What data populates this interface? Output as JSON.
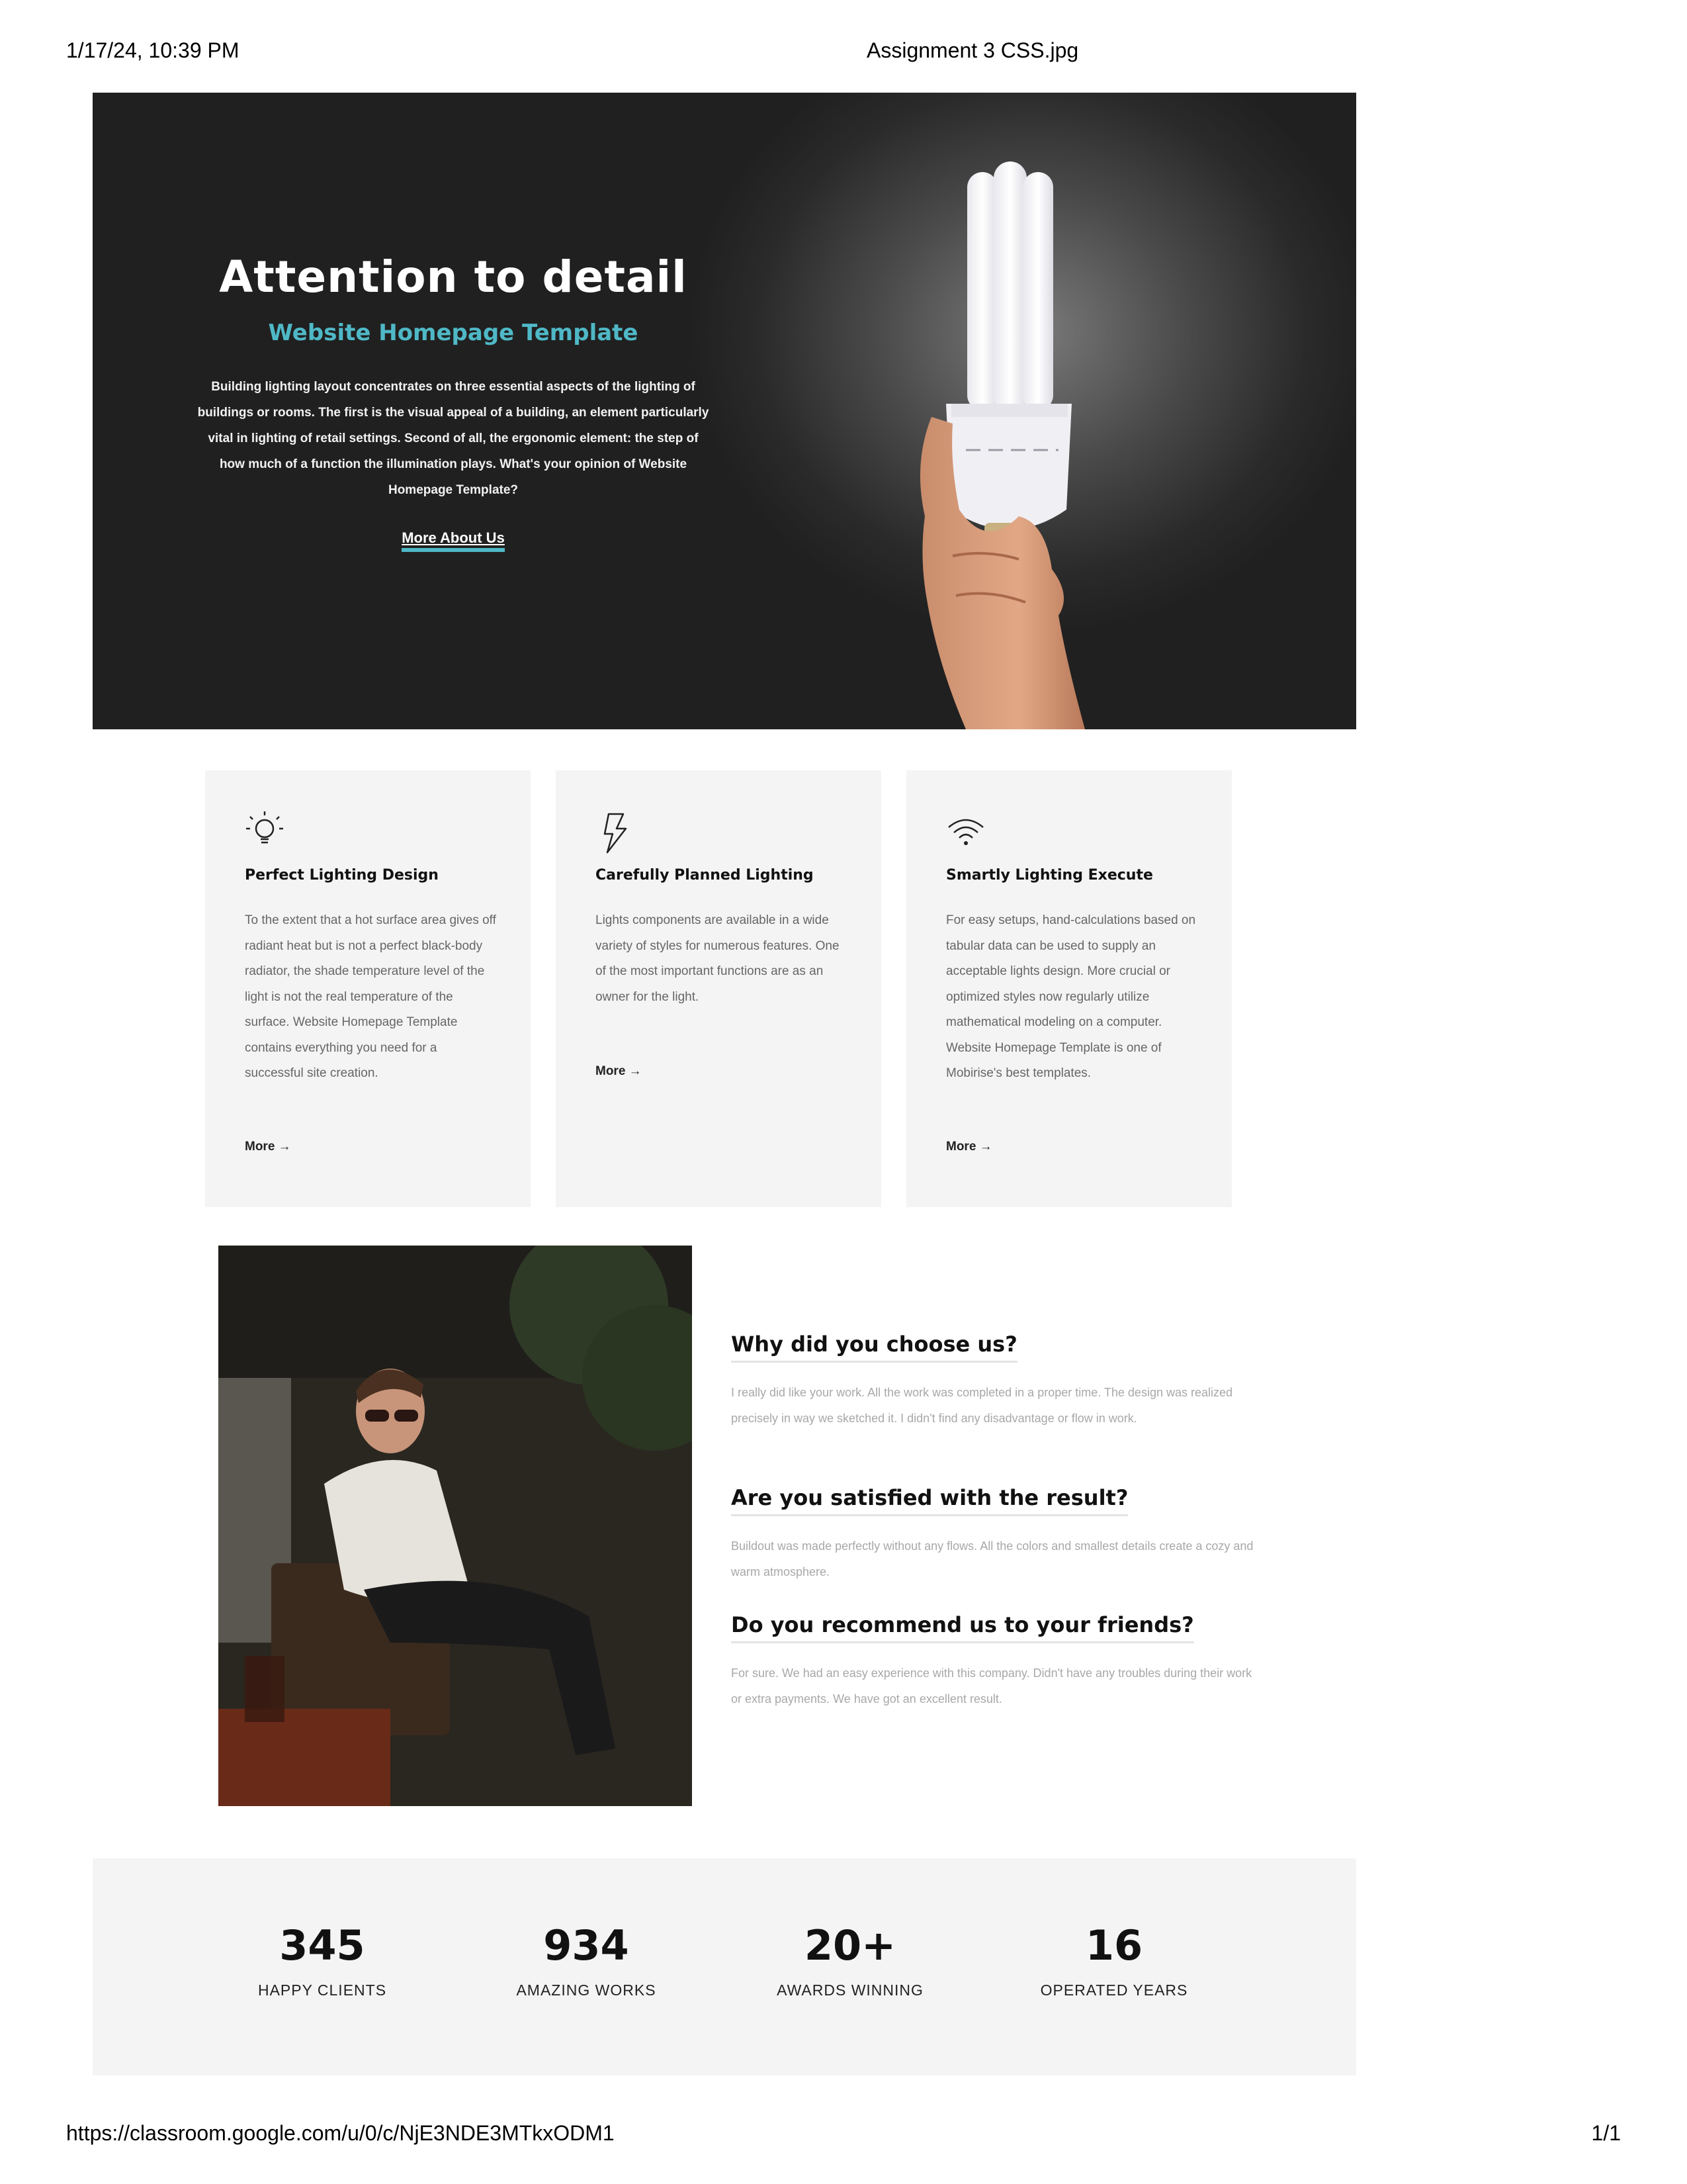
{
  "print": {
    "datetime": "1/17/24, 10:39 PM",
    "filename": "Assignment 3 CSS.jpg",
    "url": "https://classroom.google.com/u/0/c/NjE3NDE3MTkxODM1",
    "page": "1/1"
  },
  "hero": {
    "title": "Attention to detail",
    "subtitle": "Website Homepage Template",
    "body": "Building lighting layout concentrates on three essential aspects of the lighting of buildings or rooms. The first is the visual appeal of a building, an element particularly vital in lighting of retail settings. Second of all, the ergonomic element: the step of how much of a function the illumination plays. What's your opinion of Website Homepage Template?",
    "link": "More About Us"
  },
  "features": [
    {
      "icon": "bulb-icon",
      "title": "Perfect Lighting Design",
      "body": "To the extent that a hot surface area gives off radiant heat but is not a perfect black-body radiator, the shade temperature level of the light is not the real temperature of the surface. Website Homepage Template contains everything you need for a successful site creation.",
      "more": "More →"
    },
    {
      "icon": "lightning-icon",
      "title": "Carefully Planned Lighting",
      "body": "Lights components are available in a wide variety of styles for numerous features. One of the most important functions are as an owner for the light.",
      "more": "More →"
    },
    {
      "icon": "wifi-icon",
      "title": "Smartly Lighting Execute",
      "body": "For easy setups, hand-calculations based on tabular data can be used to supply an acceptable lights design. More crucial or optimized styles now regularly utilize mathematical modeling on a computer. Website Homepage Template is one of Mobirise's best templates.",
      "more": "More →"
    }
  ],
  "faq": [
    {
      "q": "Why did you choose us?",
      "a": "I really did like your work. All the work was completed in a proper time. The design was realized precisely in way we sketched it. I didn't find any disadvantage or flow in work."
    },
    {
      "q": "Are you satisfied with the result?",
      "a": "Buildout was made perfectly without any flows. All the colors and smallest details create a cozy and warm atmosphere."
    },
    {
      "q": "Do you recommend us to your friends?",
      "a": "For sure. We had an easy experience with this company. Didn't have any troubles during their work or extra payments. We have got an excellent result."
    }
  ],
  "stats": [
    {
      "number": "345",
      "label": "HAPPY CLIENTS"
    },
    {
      "number": "934",
      "label": "AMAZING WORKS"
    },
    {
      "number": "20+",
      "label": "AWARDS WINNING"
    },
    {
      "number": "16",
      "label": "OPERATED YEARS"
    }
  ],
  "colors": {
    "accent": "#4fb8c6",
    "hero_bg": "#2a2a2a",
    "card_bg": "#f4f4f4",
    "faq_text": "#a8a8a8"
  }
}
